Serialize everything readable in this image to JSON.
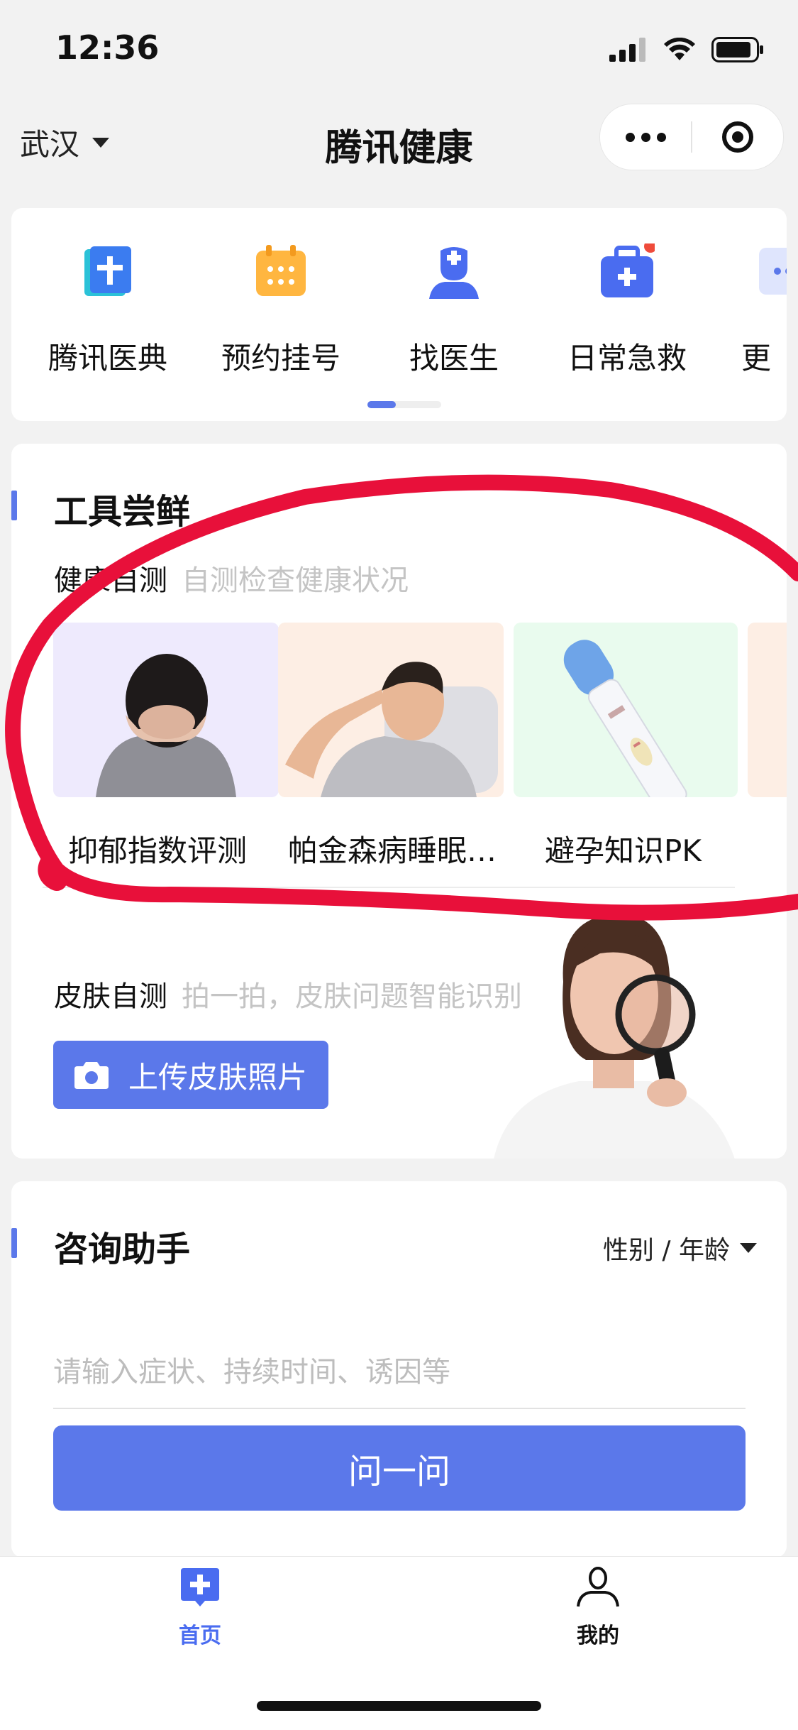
{
  "status_bar": {
    "time": "12:36"
  },
  "header": {
    "city": "武汉",
    "title": "腾讯健康"
  },
  "nav": {
    "items": [
      {
        "label": "腾讯医典",
        "icon": "medical-book-icon"
      },
      {
        "label": "预约挂号",
        "icon": "calendar-icon"
      },
      {
        "label": "找医生",
        "icon": "doctor-icon"
      },
      {
        "label": "日常急救",
        "icon": "first-aid-kit-icon"
      },
      {
        "label": "更",
        "icon": "more-grid-icon"
      }
    ]
  },
  "tools": {
    "title": "工具尝鲜",
    "self_test": {
      "label": "健康自测",
      "hint": "自测检查健康状况",
      "items": [
        {
          "label": "抑郁指数评测",
          "bg": "#eeeafd"
        },
        {
          "label": "帕金森病睡眠…",
          "bg": "#fdeee4"
        },
        {
          "label": "避孕知识PK",
          "bg": "#e9fbee"
        },
        {
          "label": "",
          "bg": "#fdeee4"
        }
      ]
    },
    "skin": {
      "label": "皮肤自测",
      "hint": "拍一拍，皮肤问题智能识别",
      "button": "上传皮肤照片"
    }
  },
  "assistant": {
    "title": "咨询助手",
    "filter": "性别 / 年龄",
    "placeholder": "请输入症状、持续时间、诱因等",
    "button": "问一问"
  },
  "tabbar": {
    "items": [
      {
        "label": "首页",
        "icon": "home-plus-icon",
        "active": true
      },
      {
        "label": "我的",
        "icon": "person-icon",
        "active": false
      }
    ]
  },
  "colors": {
    "accent": "#5b78ea",
    "annotation": "#e8103a"
  }
}
